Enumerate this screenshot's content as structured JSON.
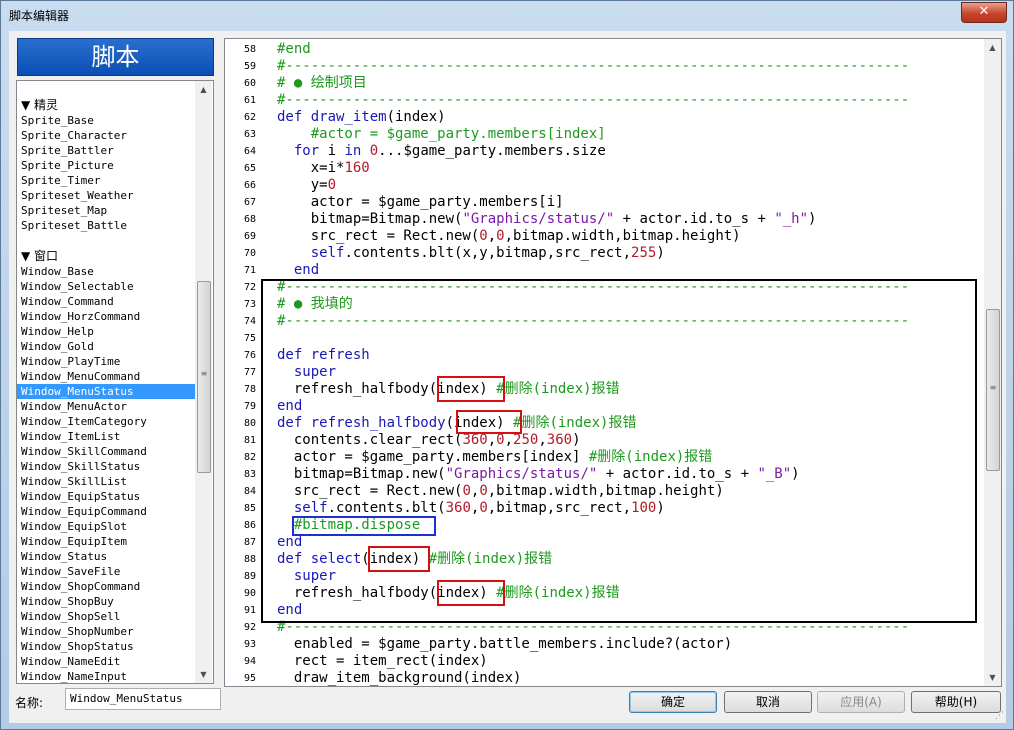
{
  "window": {
    "title": "脚本编辑器",
    "close_label": "✕"
  },
  "left": {
    "header": "脚本",
    "name_label": "名称:",
    "name_value": "Window_MenuStatus",
    "categories": [
      {
        "label": "▼ 精灵",
        "items": [
          "Sprite_Base",
          "Sprite_Character",
          "Sprite_Battler",
          "Sprite_Picture",
          "Sprite_Timer",
          "Spriteset_Weather",
          "Spriteset_Map",
          "Spriteset_Battle"
        ]
      },
      {
        "label": "▼ 窗口",
        "items": [
          "Window_Base",
          "Window_Selectable",
          "Window_Command",
          "Window_HorzCommand",
          "Window_Help",
          "Window_Gold",
          "Window_PlayTime",
          "Window_MenuCommand",
          "Window_MenuStatus",
          "Window_MenuActor",
          "Window_ItemCategory",
          "Window_ItemList",
          "Window_SkillCommand",
          "Window_SkillStatus",
          "Window_SkillList",
          "Window_EquipStatus",
          "Window_EquipCommand",
          "Window_EquipSlot",
          "Window_EquipItem",
          "Window_Status",
          "Window_SaveFile",
          "Window_ShopCommand",
          "Window_ShopBuy",
          "Window_ShopSell",
          "Window_ShopNumber",
          "Window_ShopStatus",
          "Window_NameEdit",
          "Window_NameInput"
        ]
      }
    ],
    "selected": "Window_MenuStatus"
  },
  "editor": {
    "lines": [
      {
        "n": "58",
        "t": [
          [
            "cm",
            "#end"
          ]
        ]
      },
      {
        "n": "59",
        "t": [
          [
            "cm",
            "#--------------------------------------------------------------------------"
          ]
        ]
      },
      {
        "n": "60",
        "t": [
          [
            "cm",
            "# ● 绘制项目"
          ]
        ]
      },
      {
        "n": "61",
        "t": [
          [
            "cm",
            "#--------------------------------------------------------------------------"
          ]
        ]
      },
      {
        "n": "62",
        "t": [
          [
            "kw",
            "def "
          ],
          [
            "kw",
            "draw_item"
          ],
          [
            "df",
            "(index)"
          ]
        ]
      },
      {
        "n": "63",
        "t": [
          [
            "cm",
            "    #actor = $game_party.members[index]"
          ]
        ]
      },
      {
        "n": "64",
        "t": [
          [
            "kw",
            "  for "
          ],
          [
            "df",
            "i "
          ],
          [
            "kw",
            "in "
          ],
          [
            "nm",
            "0"
          ],
          [
            "df",
            "...$game_party.members.size"
          ]
        ]
      },
      {
        "n": "65",
        "t": [
          [
            "df",
            "    x=i*"
          ],
          [
            "nm",
            "160"
          ]
        ]
      },
      {
        "n": "66",
        "t": [
          [
            "df",
            "    y="
          ],
          [
            "nm",
            "0"
          ]
        ]
      },
      {
        "n": "67",
        "t": [
          [
            "df",
            "    actor = $game_party.members[i]"
          ]
        ]
      },
      {
        "n": "68",
        "t": [
          [
            "df",
            "    bitmap=Bitmap.new("
          ],
          [
            "st",
            "\"Graphics/status/\""
          ],
          [
            "df",
            " + actor.id.to_s + "
          ],
          [
            "st",
            "\"_h\""
          ],
          [
            "df",
            ")"
          ]
        ]
      },
      {
        "n": "69",
        "t": [
          [
            "df",
            "    src_rect = Rect.new("
          ],
          [
            "nm",
            "0"
          ],
          [
            "df",
            ","
          ],
          [
            "nm",
            "0"
          ],
          [
            "df",
            ",bitmap.width,bitmap.height)"
          ]
        ]
      },
      {
        "n": "70",
        "t": [
          [
            "kw",
            "    self"
          ],
          [
            "df",
            ".contents.blt(x,y,bitmap,src_rect,"
          ],
          [
            "nm",
            "255"
          ],
          [
            "df",
            ")"
          ]
        ]
      },
      {
        "n": "71",
        "t": [
          [
            "kw",
            "  end"
          ]
        ]
      },
      {
        "n": "72",
        "t": [
          [
            "cm",
            "#--------------------------------------------------------------------------"
          ]
        ]
      },
      {
        "n": "73",
        "t": [
          [
            "cm",
            "# ● 我填的"
          ]
        ]
      },
      {
        "n": "74",
        "t": [
          [
            "cm",
            "#--------------------------------------------------------------------------"
          ]
        ]
      },
      {
        "n": "75",
        "t": []
      },
      {
        "n": "76",
        "t": [
          [
            "kw",
            "def "
          ],
          [
            "kw",
            "refresh"
          ]
        ]
      },
      {
        "n": "77",
        "t": [
          [
            "kw",
            "  super"
          ]
        ]
      },
      {
        "n": "78",
        "t": [
          [
            "df",
            "  refresh_halfbody(index) "
          ],
          [
            "cm",
            "#删除(index)报错"
          ]
        ]
      },
      {
        "n": "79",
        "t": [
          [
            "kw",
            "end"
          ]
        ]
      },
      {
        "n": "80",
        "t": [
          [
            "kw",
            "def "
          ],
          [
            "kw",
            "refresh_halfbody"
          ],
          [
            "df",
            "(index) "
          ],
          [
            "cm",
            "#删除(index)报错"
          ]
        ]
      },
      {
        "n": "81",
        "t": [
          [
            "df",
            "  contents.clear_rect("
          ],
          [
            "nm",
            "360"
          ],
          [
            "df",
            ","
          ],
          [
            "nm",
            "0"
          ],
          [
            "df",
            ","
          ],
          [
            "nm",
            "250"
          ],
          [
            "df",
            ","
          ],
          [
            "nm",
            "360"
          ],
          [
            "df",
            ")"
          ]
        ]
      },
      {
        "n": "82",
        "t": [
          [
            "df",
            "  actor = $game_party.members[index] "
          ],
          [
            "cm",
            "#删除(index)报错"
          ]
        ]
      },
      {
        "n": "83",
        "t": [
          [
            "df",
            "  bitmap=Bitmap.new("
          ],
          [
            "st",
            "\"Graphics/status/\""
          ],
          [
            "df",
            " + actor.id.to_s + "
          ],
          [
            "st",
            "\"_B\""
          ],
          [
            "df",
            ")"
          ]
        ]
      },
      {
        "n": "84",
        "t": [
          [
            "df",
            "  src_rect = Rect.new("
          ],
          [
            "nm",
            "0"
          ],
          [
            "df",
            ","
          ],
          [
            "nm",
            "0"
          ],
          [
            "df",
            ",bitmap.width,bitmap.height)"
          ]
        ]
      },
      {
        "n": "85",
        "t": [
          [
            "kw",
            "  self"
          ],
          [
            "df",
            ".contents.blt("
          ],
          [
            "nm",
            "360"
          ],
          [
            "df",
            ","
          ],
          [
            "nm",
            "0"
          ],
          [
            "df",
            ",bitmap,src_rect,"
          ],
          [
            "nm",
            "100"
          ],
          [
            "df",
            ")"
          ]
        ]
      },
      {
        "n": "86",
        "t": [
          [
            "cm",
            "  #bitmap.dispose"
          ]
        ]
      },
      {
        "n": "87",
        "t": [
          [
            "kw",
            "end"
          ]
        ]
      },
      {
        "n": "88",
        "t": [
          [
            "kw",
            "def "
          ],
          [
            "kw",
            "select"
          ],
          [
            "df",
            "(index) "
          ],
          [
            "cm",
            "#删除(index)报错"
          ]
        ]
      },
      {
        "n": "89",
        "t": [
          [
            "kw",
            "  super"
          ]
        ]
      },
      {
        "n": "90",
        "t": [
          [
            "df",
            "  refresh_halfbody(index) "
          ],
          [
            "cm",
            "#删除(index)报错"
          ]
        ]
      },
      {
        "n": "91",
        "t": [
          [
            "kw",
            "end"
          ]
        ]
      },
      {
        "n": "92",
        "t": [
          [
            "cm",
            "#--------------------------------------------------------------------------"
          ]
        ]
      },
      {
        "n": "93",
        "t": [
          [
            "df",
            "  enabled = $game_party.battle_members.include?(actor)"
          ]
        ]
      },
      {
        "n": "94",
        "t": [
          [
            "df",
            "  rect = item_rect(index)"
          ]
        ]
      },
      {
        "n": "95",
        "t": [
          [
            "df",
            "  draw_item_background(index)"
          ]
        ]
      }
    ]
  },
  "buttons": {
    "ok": "确定",
    "cancel": "取消",
    "apply": "应用(A)",
    "help": "帮助(H)"
  }
}
